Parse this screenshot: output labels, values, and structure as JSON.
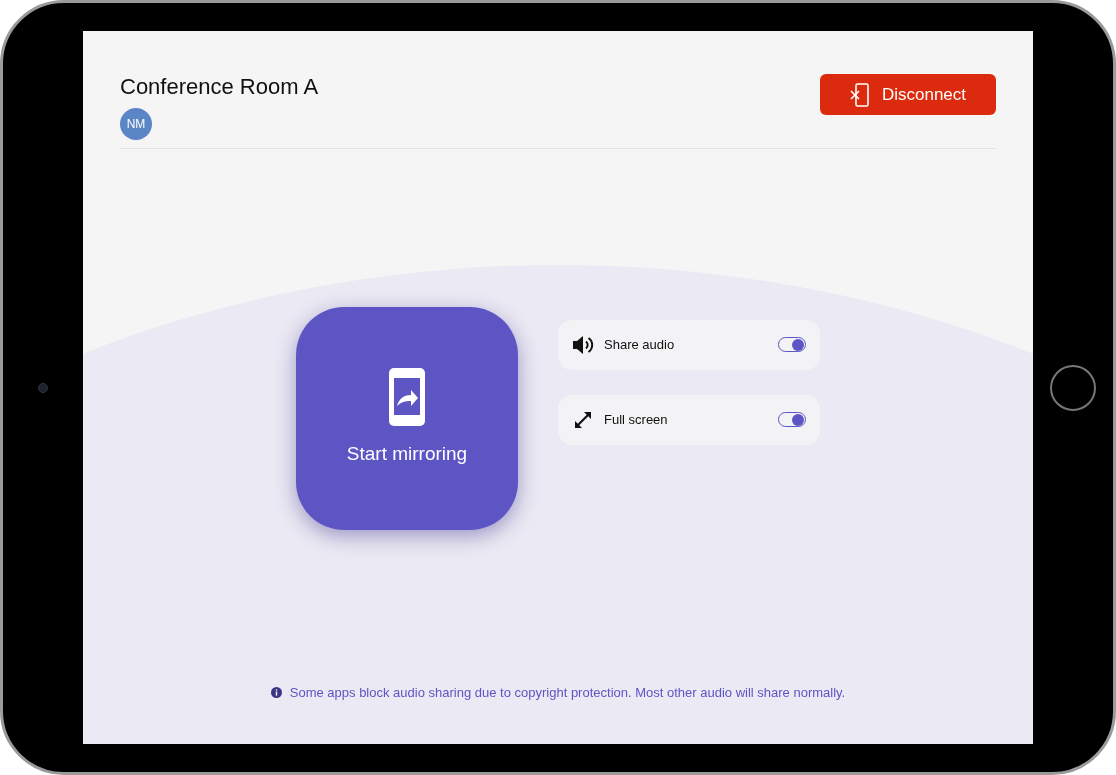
{
  "header": {
    "title": "Conference Room A",
    "avatar": "NM",
    "disconnect_button": "Disconnect"
  },
  "mirror_button": {
    "label": "Start mirroring"
  },
  "options": [
    {
      "label": "Share audio",
      "on": true
    },
    {
      "label": "Full screen",
      "on": true
    }
  ],
  "notice": "Some apps block audio sharing due to copyright protection. Most other audio will share normally."
}
